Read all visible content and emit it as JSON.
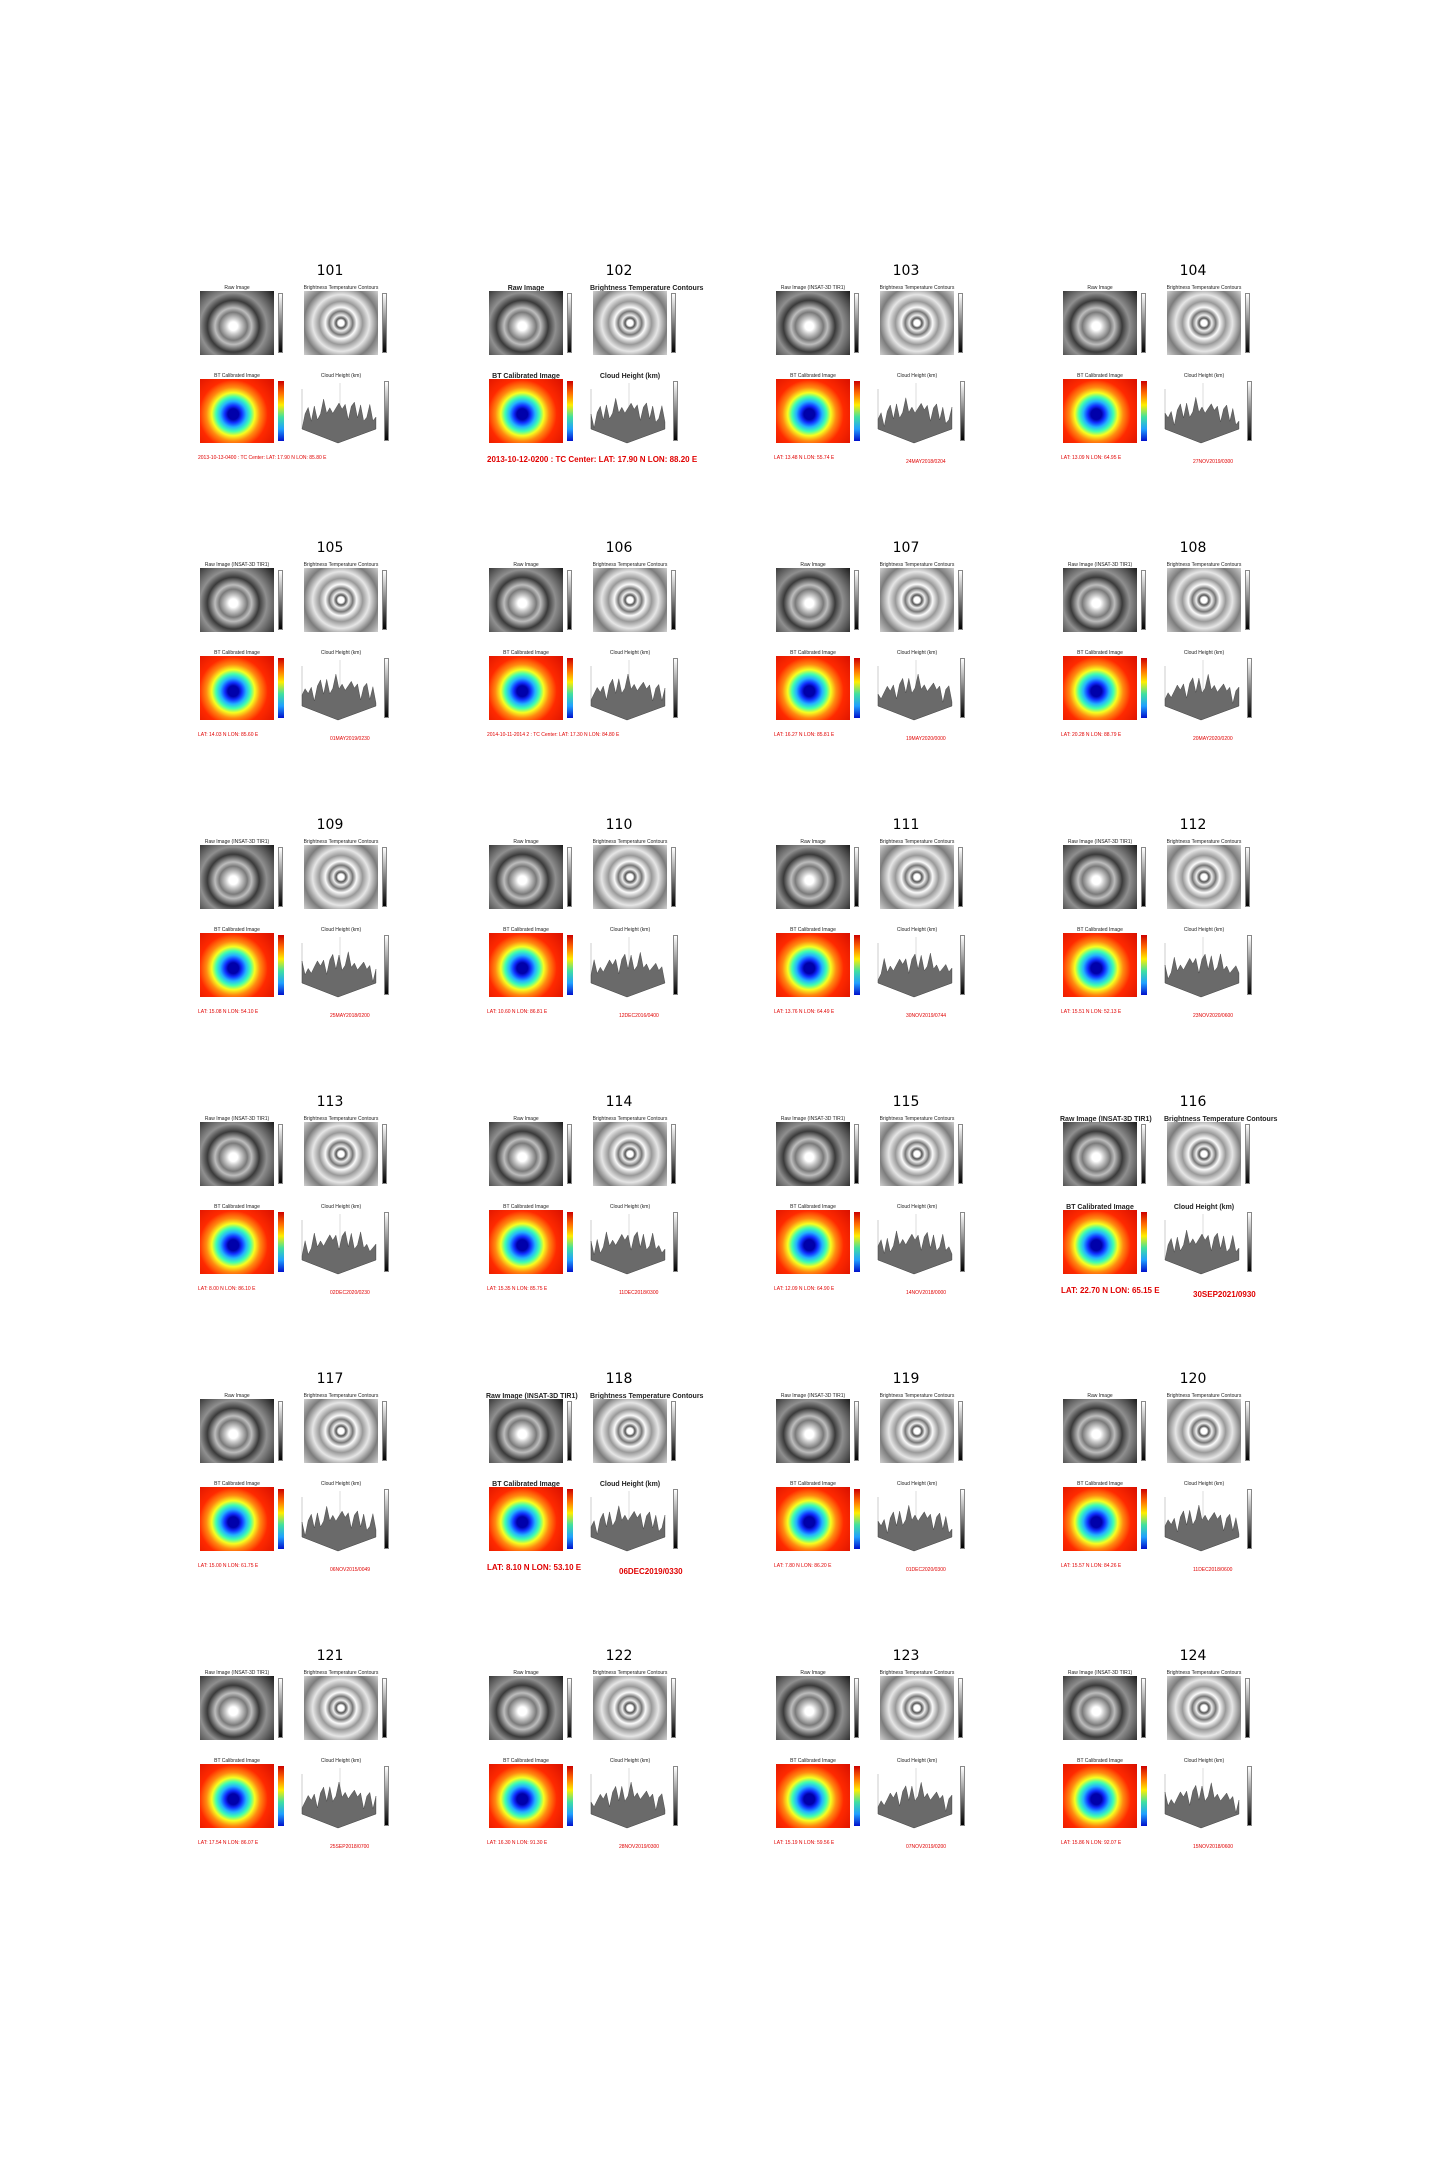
{
  "panel_labels": {
    "raw": "Raw Image",
    "raw_insat": "Raw Image (INSAT-3D TIR1)",
    "bt_contours": "Brightness Temperature Contours",
    "bt_calibrated": "BT Calibrated Image",
    "cloud_height": "Cloud Height (km)"
  },
  "cells": [
    {
      "number": "101",
      "raw": "raw",
      "cap_left": "2013-10-13-0400 : TC Center: LAT: 17.90 N LON: 85.80 E",
      "cap_right": "",
      "big": false
    },
    {
      "number": "102",
      "raw": "raw",
      "cap_left": "2013-10-12-0200 : TC Center: LAT: 17.90 N LON: 88.20 E",
      "cap_right": "",
      "big": true
    },
    {
      "number": "103",
      "raw": "raw_insat",
      "cap_left": "LAT: 13.48 N LON: 55.74 E",
      "cap_right": "24MAY2018/0204",
      "big": false
    },
    {
      "number": "104",
      "raw": "raw",
      "cap_left": "LAT: 13.09 N LON: 64.95 E",
      "cap_right": "27NOV2019/0300",
      "big": false
    },
    {
      "number": "105",
      "raw": "raw_insat",
      "cap_left": "LAT: 14.03 N LON: 85.60 E",
      "cap_right": "01MAY2019/0230",
      "big": false
    },
    {
      "number": "106",
      "raw": "raw",
      "cap_left": "2014-10-11-2014 2 : TC Center: LAT: 17.30 N LON: 84.80 E",
      "cap_right": "",
      "big": false
    },
    {
      "number": "107",
      "raw": "raw",
      "cap_left": "LAT: 16.27 N LON: 85.81 E",
      "cap_right": "19MAY2020/0000",
      "big": false
    },
    {
      "number": "108",
      "raw": "raw_insat",
      "cap_left": "LAT: 20.28 N LON: 88.79 E",
      "cap_right": "20MAY2020/0200",
      "big": false
    },
    {
      "number": "109",
      "raw": "raw_insat",
      "cap_left": "LAT: 15.08 N LON: 54.10 E",
      "cap_right": "25MAY2018/0200",
      "big": false
    },
    {
      "number": "110",
      "raw": "raw",
      "cap_left": "LAT: 10.60 N LON: 86.81 E",
      "cap_right": "12DEC2016/0400",
      "big": false
    },
    {
      "number": "111",
      "raw": "raw",
      "cap_left": "LAT: 13.76 N LON: 64.49 E",
      "cap_right": "30NOV2019/0744",
      "big": false
    },
    {
      "number": "112",
      "raw": "raw_insat",
      "cap_left": "LAT: 15.51 N LON: 52.13 E",
      "cap_right": "23NOV2020/0600",
      "big": false
    },
    {
      "number": "113",
      "raw": "raw_insat",
      "cap_left": "LAT: 8.00 N LON: 86.10 E",
      "cap_right": "02DEC2020/0230",
      "big": false
    },
    {
      "number": "114",
      "raw": "raw",
      "cap_left": "LAT: 15.35 N LON: 85.75 E",
      "cap_right": "11DEC2018/0300",
      "big": false
    },
    {
      "number": "115",
      "raw": "raw_insat",
      "cap_left": "LAT: 12.09 N LON: 64.90 E",
      "cap_right": "14NOV2018/0000",
      "big": false
    },
    {
      "number": "116",
      "raw": "raw_insat",
      "cap_left": "LAT: 22.70 N LON: 65.15 E",
      "cap_right": "30SEP2021/0930",
      "big": true
    },
    {
      "number": "117",
      "raw": "raw",
      "cap_left": "LAT: 15.00 N LON: 61.75 E",
      "cap_right": "06NOV2015/0049",
      "big": false
    },
    {
      "number": "118",
      "raw": "raw_insat",
      "cap_left": "LAT: 8.10 N LON: 53.10 E",
      "cap_right": "06DEC2019/0330",
      "big": true
    },
    {
      "number": "119",
      "raw": "raw_insat",
      "cap_left": "LAT: 7.80 N LON: 86.20 E",
      "cap_right": "01DEC2020/0300",
      "big": false
    },
    {
      "number": "120",
      "raw": "raw",
      "cap_left": "LAT: 15.57 N LON: 84.26 E",
      "cap_right": "11DEC2018/0600",
      "big": false
    },
    {
      "number": "121",
      "raw": "raw_insat",
      "cap_left": "LAT: 17.54 N LON: 86.07 E",
      "cap_right": "25SEP2018/0700",
      "big": false
    },
    {
      "number": "122",
      "raw": "raw",
      "cap_left": "LAT: 16.30 N LON: 91.30 E",
      "cap_right": "28NOV2019/0300",
      "big": false
    },
    {
      "number": "123",
      "raw": "raw",
      "cap_left": "LAT: 15.19 N LON: 59.56 E",
      "cap_right": "07NOV2019/0200",
      "big": false
    },
    {
      "number": "124",
      "raw": "raw_insat",
      "cap_left": "LAT: 15.86 N LON: 92.07 E",
      "cap_right": "15NOV2018/0600",
      "big": false
    }
  ],
  "colors": {
    "caption_red": "#e00000",
    "title_black": "#000000"
  }
}
